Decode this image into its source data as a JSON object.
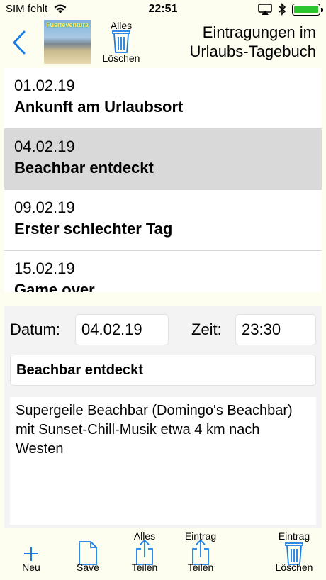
{
  "status_bar": {
    "carrier": "SIM fehlt",
    "time": "22:51"
  },
  "nav": {
    "thumbnail_label": "Fuerteventura",
    "delete_all_top": "Alles",
    "delete_all_bottom": "Löschen",
    "title_line1": "Eintragungen im",
    "title_line2": "Urlaubs-Tagebuch"
  },
  "entries": [
    {
      "date": "01.02.19",
      "title": "Ankunft am Urlaubsort"
    },
    {
      "date": "04.02.19",
      "title": "Beachbar entdeckt"
    },
    {
      "date": "09.02.19",
      "title": "Erster schlechter Tag"
    },
    {
      "date": "15.02.19",
      "title": "Game over"
    }
  ],
  "selected_index": 1,
  "detail": {
    "date_label": "Datum:",
    "date_value": "04.02.19",
    "time_label": "Zeit:",
    "time_value": "23:30",
    "title_value": "Beachbar entdeckt",
    "text_value": "Supergeile Beachbar (Domingo's Beachbar) mit Sunset-Chill-Musik etwa 4 km nach Westen"
  },
  "toolbar": {
    "new_label": "Neu",
    "save_label": "Save",
    "share_all_top": "Alles",
    "share_all_bottom": "Teilen",
    "share_entry_top": "Eintrag",
    "share_entry_bottom": "Teilen",
    "delete_entry_top": "Eintrag",
    "delete_entry_bottom": "Löschen"
  },
  "colors": {
    "accent": "#1a7de6",
    "background": "#fdfdf0",
    "selected_row": "#d9d9d9",
    "battery": "#2dc52d"
  },
  "icons": {
    "back": "chevron-left-icon",
    "delete": "trash-icon",
    "new": "plus-icon",
    "save": "document-icon",
    "share": "share-icon"
  }
}
